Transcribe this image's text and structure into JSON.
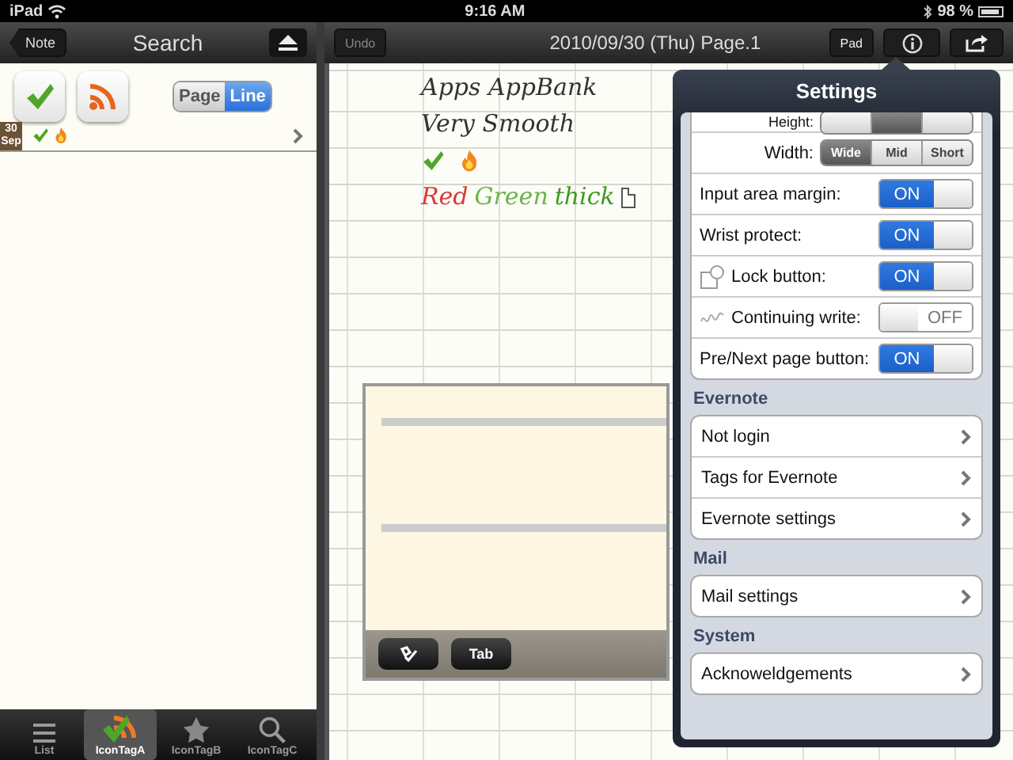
{
  "status_bar": {
    "device": "iPad",
    "time": "9:16 AM",
    "battery": "98 %"
  },
  "left_nav": {
    "back": "Note",
    "title": "Search"
  },
  "icon_tags": [
    {
      "kind": "check"
    },
    {
      "kind": "rss"
    }
  ],
  "view_mode": [
    {
      "label": "Page",
      "selected": false
    },
    {
      "label": "Line",
      "selected": true
    }
  ],
  "results": [
    {
      "day": "30",
      "month": "Sep",
      "tags": [
        {
          "kind": "check"
        },
        {
          "kind": "flame"
        }
      ]
    }
  ],
  "tab_bar": [
    {
      "label": "List",
      "kind": "list",
      "selected": false
    },
    {
      "label": "IconTagA",
      "kind": "tags",
      "selected": true
    },
    {
      "label": "IconTagB",
      "kind": "star",
      "selected": false
    },
    {
      "label": "IconTagC",
      "kind": "search",
      "selected": false
    }
  ],
  "right_nav": {
    "undo": "Undo",
    "title": "2010/09/30 (Thu) Page.1",
    "pad": "Pad"
  },
  "handwriting": [
    [
      {
        "text": "Apps AppBank",
        "color": "#333333"
      }
    ],
    [
      {
        "text": "Very Smooth",
        "color": "#333333"
      }
    ],
    [
      {
        "text": "Red",
        "color": "#d83a34"
      },
      {
        "text": "Green",
        "color": "#6bb34a"
      },
      {
        "text": "thick",
        "color": "#3d9a1e"
      }
    ]
  ],
  "input_area": {
    "buttons": [
      {
        "kind": "icon"
      },
      {
        "kind": "text",
        "label": "Tab"
      }
    ]
  },
  "settings": {
    "title": "Settings",
    "height": {
      "label": "Height:",
      "options": [
        {
          "selected": false
        },
        {
          "selected": true
        },
        {
          "selected": false
        }
      ]
    },
    "width": {
      "label": "Width:",
      "options": [
        {
          "label": "Wide",
          "selected": true
        },
        {
          "label": "Mid",
          "selected": false
        },
        {
          "label": "Short",
          "selected": false
        }
      ]
    },
    "toggles": [
      {
        "label": "Input area margin:",
        "on": true,
        "state_text": "ON",
        "kind": "plain"
      },
      {
        "label": "Wrist protect:",
        "on": true,
        "state_text": "ON",
        "kind": "plain"
      },
      {
        "label": "Lock button:",
        "on": true,
        "state_text": "ON",
        "kind": "lock"
      },
      {
        "label": "Continuing write:",
        "on": false,
        "state_text": "OFF",
        "kind": "wave"
      },
      {
        "label": "Pre/Next page button:",
        "on": true,
        "state_text": "ON",
        "kind": "plain"
      }
    ],
    "sections": [
      {
        "header": "Evernote",
        "items": [
          "Not login",
          "Tags for Evernote",
          "Evernote settings"
        ]
      },
      {
        "header": "Mail",
        "items": [
          "Mail settings"
        ]
      },
      {
        "header": "System",
        "items": [
          "Acknoweldgements"
        ]
      }
    ]
  }
}
